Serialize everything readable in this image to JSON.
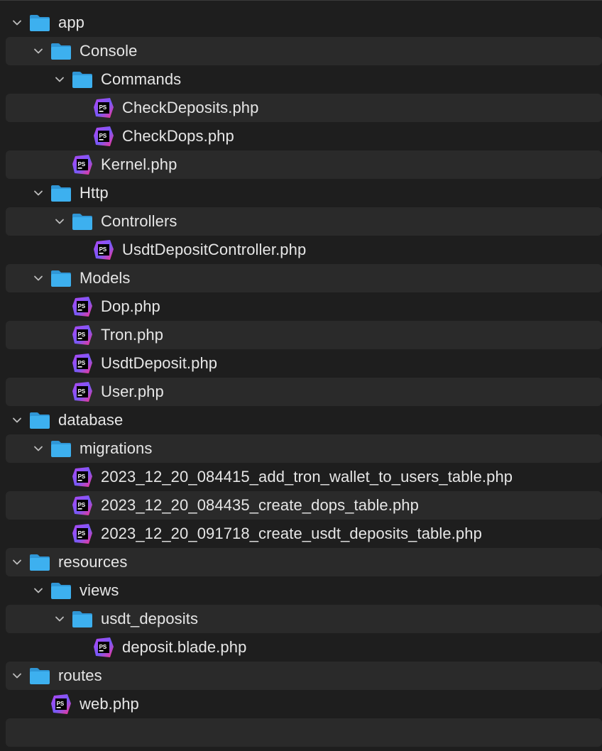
{
  "tree": [
    {
      "label": "app",
      "type": "folder",
      "depth": 0
    },
    {
      "label": "Console",
      "type": "folder",
      "depth": 1
    },
    {
      "label": "Commands",
      "type": "folder",
      "depth": 2
    },
    {
      "label": "CheckDeposits.php",
      "type": "file",
      "depth": 3
    },
    {
      "label": "CheckDops.php",
      "type": "file",
      "depth": 3
    },
    {
      "label": "Kernel.php",
      "type": "file",
      "depth": 2
    },
    {
      "label": "Http",
      "type": "folder",
      "depth": 1
    },
    {
      "label": "Controllers",
      "type": "folder",
      "depth": 2
    },
    {
      "label": "UsdtDepositController.php",
      "type": "file",
      "depth": 3
    },
    {
      "label": "Models",
      "type": "folder",
      "depth": 1
    },
    {
      "label": "Dop.php",
      "type": "file",
      "depth": 2
    },
    {
      "label": "Tron.php",
      "type": "file",
      "depth": 2
    },
    {
      "label": "UsdtDeposit.php",
      "type": "file",
      "depth": 2
    },
    {
      "label": "User.php",
      "type": "file",
      "depth": 2
    },
    {
      "label": "database",
      "type": "folder",
      "depth": 0
    },
    {
      "label": "migrations",
      "type": "folder",
      "depth": 1
    },
    {
      "label": "2023_12_20_084415_add_tron_wallet_to_users_table.php",
      "type": "file",
      "depth": 2
    },
    {
      "label": "2023_12_20_084435_create_dops_table.php",
      "type": "file",
      "depth": 2
    },
    {
      "label": "2023_12_20_091718_create_usdt_deposits_table.php",
      "type": "file",
      "depth": 2
    },
    {
      "label": "resources",
      "type": "folder",
      "depth": 0
    },
    {
      "label": "views",
      "type": "folder",
      "depth": 1
    },
    {
      "label": "usdt_deposits",
      "type": "folder",
      "depth": 2
    },
    {
      "label": "deposit.blade.php",
      "type": "file",
      "depth": 3
    },
    {
      "label": "routes",
      "type": "folder",
      "depth": 0
    },
    {
      "label": "web.php",
      "type": "file",
      "depth": 1
    }
  ],
  "icons": {
    "folder": "folder-icon",
    "file": "phpstorm-file-icon",
    "chevron": "chevron-down-icon",
    "file_badge_text": "PS"
  },
  "colors": {
    "background": "#1e1e1e",
    "row_alt": "#2a2a2a",
    "folder": "#3aa8e8",
    "text": "#e6e6e6",
    "chevron": "#bdbdbd"
  }
}
